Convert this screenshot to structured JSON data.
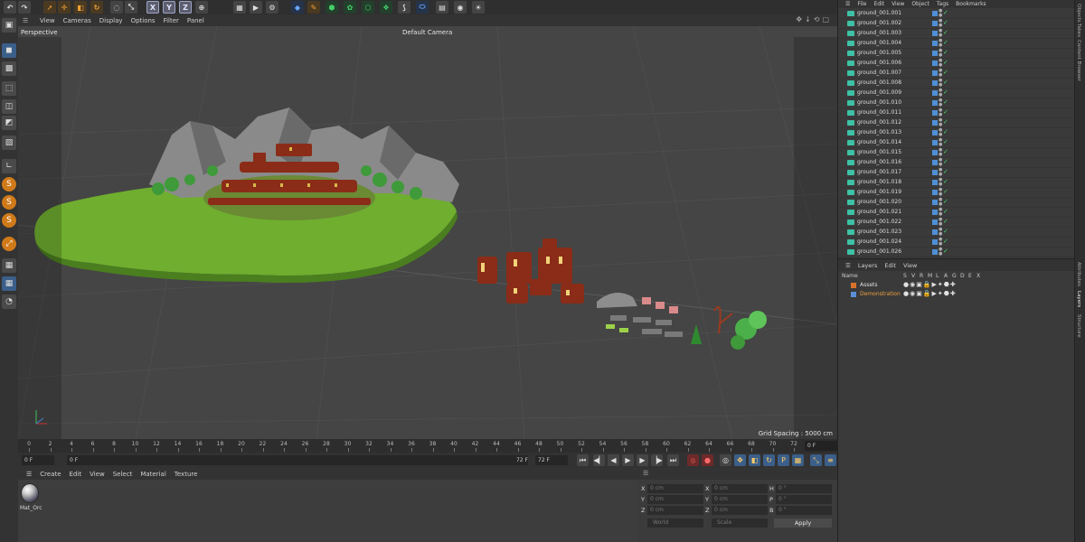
{
  "toolbar": {
    "axis_x": "X",
    "axis_y": "Y",
    "axis_z": "Z"
  },
  "viewport_menu": {
    "items": [
      "View",
      "Cameras",
      "Display",
      "Options",
      "Filter",
      "Panel"
    ]
  },
  "viewport": {
    "label": "Perspective",
    "camera": "Default Camera",
    "grid_spacing": "Grid Spacing : 5000 cm"
  },
  "timeline": {
    "ticks": [
      "0",
      "2",
      "4",
      "6",
      "8",
      "10",
      "12",
      "14",
      "16",
      "18",
      "20",
      "22",
      "24",
      "26",
      "28",
      "30",
      "32",
      "34",
      "36",
      "38",
      "40",
      "42",
      "44",
      "46",
      "48",
      "50",
      "52",
      "54",
      "56",
      "58",
      "60",
      "62",
      "64",
      "66",
      "68",
      "70",
      "72"
    ],
    "current_frame": "0 F"
  },
  "transport": {
    "start": "0 F",
    "range_start": "0 F",
    "range_end": "72 F",
    "end": "72 F"
  },
  "material_menu": {
    "items": [
      "Create",
      "Edit",
      "View",
      "Select",
      "Material",
      "Texture"
    ]
  },
  "materials": [
    {
      "name": "Mat_Orc"
    }
  ],
  "coordinates": {
    "rows": [
      {
        "a_label": "X",
        "a_val": "0 cm",
        "b_label": "X",
        "b_val": "0 cm",
        "c_label": "H",
        "c_val": "0 °"
      },
      {
        "a_label": "Y",
        "a_val": "0 cm",
        "b_label": "Y",
        "b_val": "0 cm",
        "c_label": "P",
        "c_val": "0 °"
      },
      {
        "a_label": "Z",
        "a_val": "0 cm",
        "b_label": "Z",
        "b_val": "0 cm",
        "c_label": "B",
        "c_val": "0 °"
      }
    ],
    "mode1": "World",
    "mode2": "Scale",
    "apply": "Apply"
  },
  "object_manager": {
    "menu": [
      "File",
      "Edit",
      "View",
      "Object",
      "Tags",
      "Bookmarks"
    ],
    "objects": [
      "ground_001.001",
      "ground_001.002",
      "ground_001.003",
      "ground_001.004",
      "ground_001.005",
      "ground_001.006",
      "ground_001.007",
      "ground_001.008",
      "ground_001.009",
      "ground_001.010",
      "ground_001.011",
      "ground_001.012",
      "ground_001.013",
      "ground_001.014",
      "ground_001.015",
      "ground_001.016",
      "ground_001.017",
      "ground_001.018",
      "ground_001.019",
      "ground_001.020",
      "ground_001.021",
      "ground_001.022",
      "ground_001.023",
      "ground_001.024",
      "ground_001.026"
    ]
  },
  "layer_manager": {
    "menu": [
      "Layers",
      "Edit",
      "View"
    ],
    "columns": [
      "Name",
      "S",
      "V",
      "R",
      "M",
      "L",
      "A",
      "G",
      "D",
      "E",
      "X"
    ],
    "layers": [
      {
        "name": "Assets",
        "color": "#d9722a",
        "text_color": "#e0e0e0"
      },
      {
        "name": "Demonstration",
        "color": "#5a8fd8",
        "text_color": "#f0a040"
      }
    ]
  },
  "side_tabs": [
    "Objects",
    "Takes",
    "Content Browser",
    "Attributes",
    "Layers",
    "Structure"
  ],
  "colors": {
    "accent_orange": "#f3a437",
    "object_icon": "#3ec1a6",
    "grass": "#7dc23a"
  }
}
